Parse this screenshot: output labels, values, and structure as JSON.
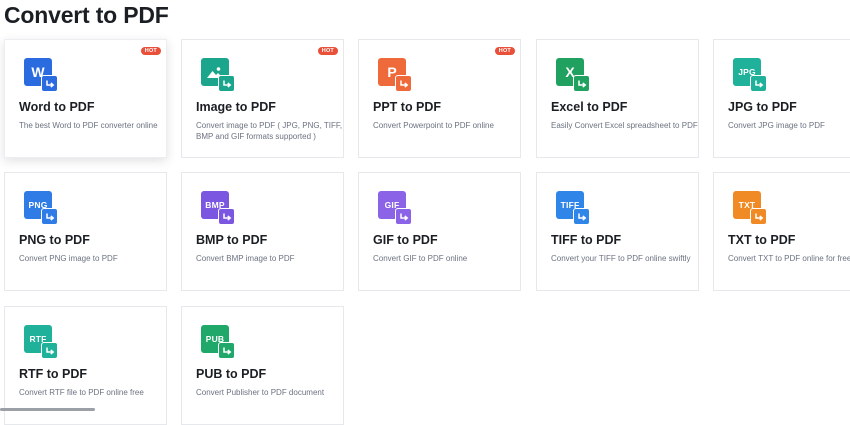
{
  "page": {
    "title": "Convert to PDF"
  },
  "hot_label": "HOT",
  "cards": [
    {
      "id": "word",
      "name": "Word to PDF",
      "desc": "The best Word to PDF converter online",
      "icon": "word-icon",
      "icon_label": "W",
      "color": "#2b6be0",
      "arrow_color": "#2b6be0",
      "hot": true
    },
    {
      "id": "image",
      "name": "Image to PDF",
      "desc": "Convert image to PDF ( JPG, PNG, TIFF, BMP and GIF formats supported )",
      "icon": "image-icon",
      "icon_label": "",
      "color": "#1aa58c",
      "arrow_color": "#1aa58c",
      "hot": true
    },
    {
      "id": "ppt",
      "name": "PPT to PDF",
      "desc": "Convert Powerpoint to PDF online",
      "icon": "powerpoint-icon",
      "icon_label": "P",
      "color": "#ef6a3a",
      "arrow_color": "#ef6a3a",
      "hot": true
    },
    {
      "id": "excel",
      "name": "Excel to PDF",
      "desc": "Easily Convert Excel spreadsheet to PDF",
      "icon": "excel-icon",
      "icon_label": "X",
      "color": "#20a160",
      "arrow_color": "#20a160",
      "hot": false
    },
    {
      "id": "jpg",
      "name": "JPG to PDF",
      "desc": "Convert JPG image to PDF",
      "icon": "jpg-icon",
      "icon_label": "JPG",
      "color": "#1fb19a",
      "arrow_color": "#1fb19a",
      "hot": false
    },
    {
      "id": "png",
      "name": "PNG to PDF",
      "desc": "Convert PNG image to PDF",
      "icon": "png-icon",
      "icon_label": "PNG",
      "color": "#2f7ce6",
      "arrow_color": "#2f7ce6",
      "hot": false
    },
    {
      "id": "bmp",
      "name": "BMP to PDF",
      "desc": "Convert BMP image to PDF",
      "icon": "bmp-icon",
      "icon_label": "BMP",
      "color": "#7b56e0",
      "arrow_color": "#7b56e0",
      "hot": false
    },
    {
      "id": "gif",
      "name": "GIF to PDF",
      "desc": "Convert GIF to PDF online",
      "icon": "gif-icon",
      "icon_label": "GIF",
      "color": "#8b63e6",
      "arrow_color": "#8b63e6",
      "hot": false
    },
    {
      "id": "tiff",
      "name": "TIFF to PDF",
      "desc": "Convert your TIFF to PDF online swiftly",
      "icon": "tiff-icon",
      "icon_label": "TIFF",
      "color": "#2f86e8",
      "arrow_color": "#2f86e8",
      "hot": false
    },
    {
      "id": "txt",
      "name": "TXT to PDF",
      "desc": "Convert TXT to PDF online for free",
      "icon": "txt-icon",
      "icon_label": "TXT",
      "color": "#f08a24",
      "arrow_color": "#f08a24",
      "hot": false
    },
    {
      "id": "rtf",
      "name": "RTF to PDF",
      "desc": "Convert RTF file to PDF online free",
      "icon": "rtf-icon",
      "icon_label": "RTF",
      "color": "#1fb19a",
      "arrow_color": "#1fb19a",
      "hot": false
    },
    {
      "id": "pub",
      "name": "PUB to PDF",
      "desc": "Convert Publisher to PDF document",
      "icon": "publisher-icon",
      "icon_label": "PUB",
      "color": "#1fa86a",
      "arrow_color": "#1fa86a",
      "hot": false
    }
  ]
}
